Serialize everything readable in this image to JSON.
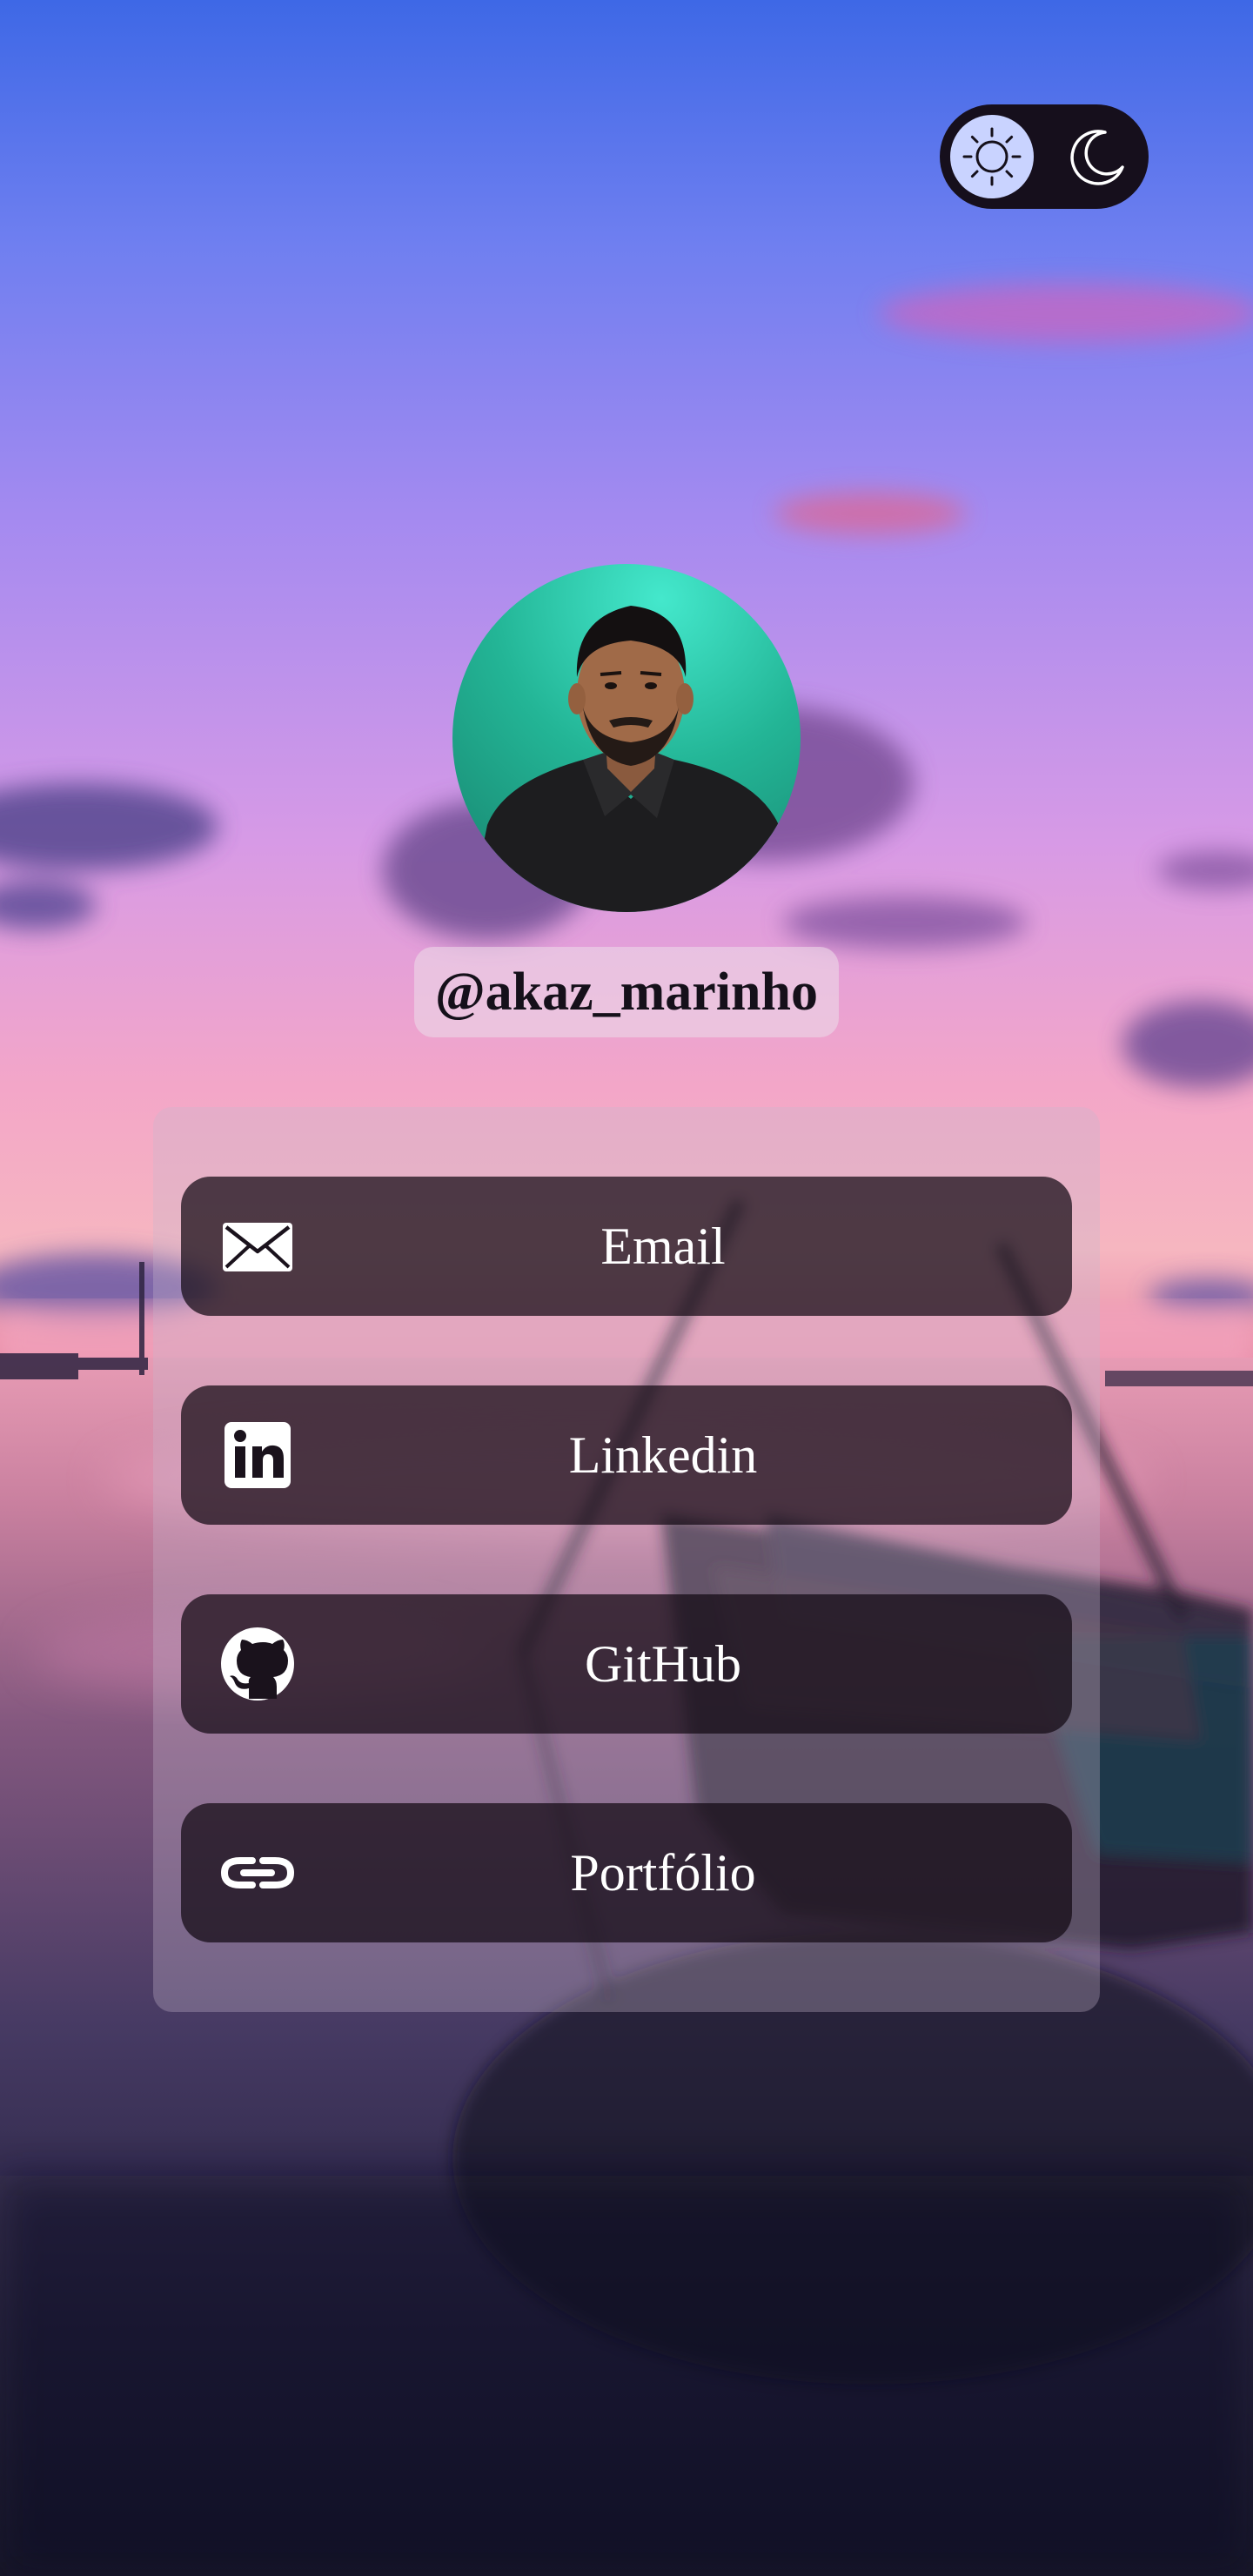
{
  "profile": {
    "username": "@akaz_marinho"
  },
  "theme_toggle": {
    "options": [
      {
        "icon": "sun-icon",
        "selected": true
      },
      {
        "icon": "moon-icon",
        "selected": false
      }
    ]
  },
  "links": [
    {
      "label": "Email",
      "icon": "envelope-icon"
    },
    {
      "label": "Linkedin",
      "icon": "linkedin-icon"
    },
    {
      "label": "GitHub",
      "icon": "github-icon"
    },
    {
      "label": "Portfólio",
      "icon": "link-icon"
    }
  ],
  "colors": {
    "toggle_background": "#160f1c",
    "toggle_selected": "#c9d3ff",
    "button_background": "#120a14",
    "button_text": "#ffffff",
    "username_text": "#15101a"
  }
}
